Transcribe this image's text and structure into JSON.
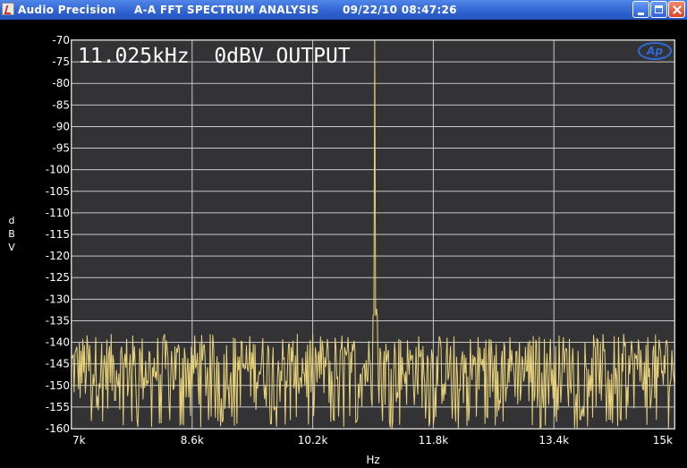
{
  "window": {
    "app_name": "Audio Precision",
    "title": "A-A FFT SPECTRUM ANALYSIS",
    "timestamp": "09/22/10 08:47:26"
  },
  "logo_text": "Ap",
  "chart_data": {
    "type": "line",
    "annotation": "11.025kHz  0dBV OUTPUT",
    "xlabel": "Hz",
    "ylabel": [
      "d",
      "B",
      "V"
    ],
    "xlim": [
      7000,
      15000
    ],
    "ylim": [
      -160,
      -70
    ],
    "x_ticks": [
      {
        "value": 7000,
        "label": "7k"
      },
      {
        "value": 8600,
        "label": "8.6k"
      },
      {
        "value": 10200,
        "label": "10.2k"
      },
      {
        "value": 11800,
        "label": "11.8k"
      },
      {
        "value": 13400,
        "label": "13.4k"
      },
      {
        "value": 15000,
        "label": "15k"
      }
    ],
    "x_grid_values": [
      7000,
      8600,
      10200,
      11800,
      13400,
      15000
    ],
    "y_ticks": [
      -70,
      -75,
      -80,
      -85,
      -90,
      -95,
      -100,
      -105,
      -110,
      -115,
      -120,
      -125,
      -130,
      -135,
      -140,
      -145,
      -150,
      -155,
      -160
    ],
    "grid": true,
    "series": [
      {
        "color": "#e8d27a",
        "noise_floor_range": [
          -160,
          -138
        ],
        "peak": {
          "x": 11025,
          "y": -70
        }
      }
    ]
  }
}
